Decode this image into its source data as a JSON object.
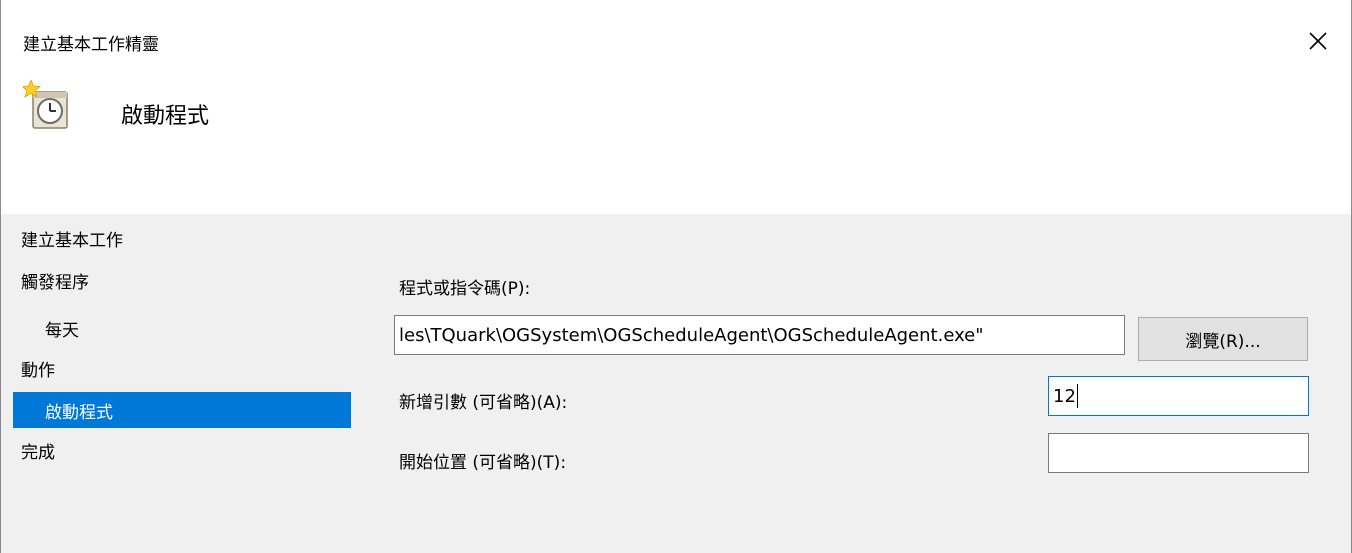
{
  "window": {
    "title": "建立基本工作精靈"
  },
  "header": {
    "title": "啟動程式",
    "icon": "scheduled-task-clock-icon"
  },
  "nav": {
    "items": [
      {
        "label": "建立基本工作"
      },
      {
        "label": "觸發程序"
      },
      {
        "label": "每天"
      },
      {
        "label": "動作"
      },
      {
        "label": "啟動程式"
      },
      {
        "label": "完成"
      }
    ],
    "active_index": 4
  },
  "form": {
    "program_label": "程式或指令碼(P):",
    "program_value": "les\\TQuark\\OGSystem\\OGScheduleAgent\\OGScheduleAgent.exe\"",
    "browse_label": "瀏覽(R)...",
    "args_label": "新增引數 (可省略)(A):",
    "args_value": "12",
    "start_in_label": "開始位置 (可省略)(T):",
    "start_in_value": ""
  },
  "colors": {
    "selection": "#0078d7",
    "panel_bg": "#f0f0f0",
    "focus_border": "#0078d7"
  }
}
